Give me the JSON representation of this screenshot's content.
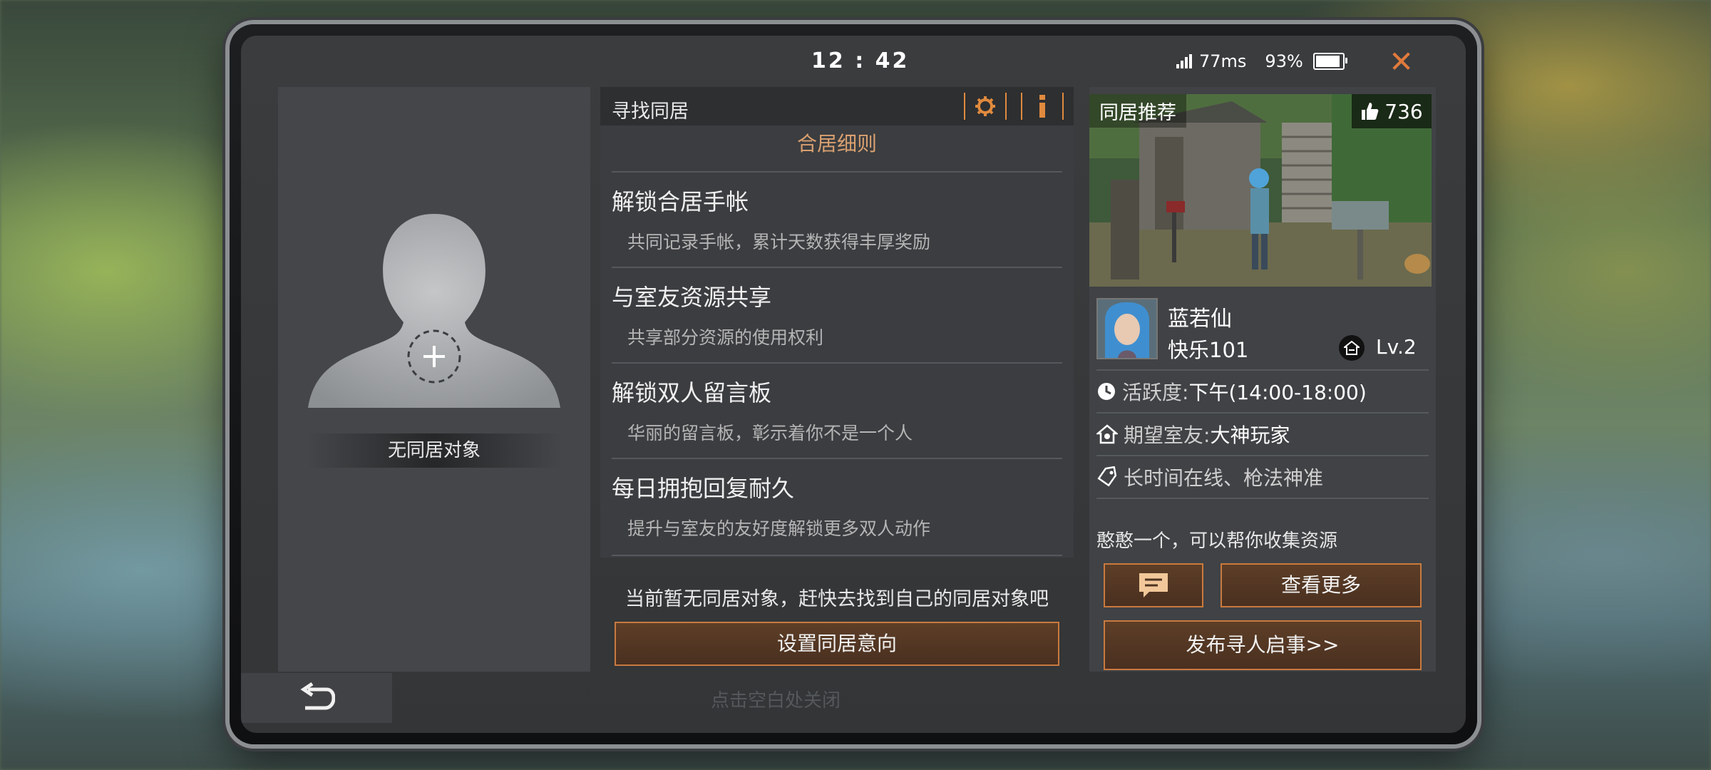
{
  "status_bar": {
    "time": "12 : 42",
    "ping": "77ms",
    "battery": "93%",
    "battery_level": 0.93
  },
  "left": {
    "no_partner_label": "无同居对象",
    "close_hint": "点击空白处关闭"
  },
  "middle": {
    "title": "寻找同居",
    "rules_title": "合居细则",
    "rules": [
      {
        "title": "解锁合居手帐",
        "desc": "共同记录手帐，累计天数获得丰厚奖励"
      },
      {
        "title": "与室友资源共享",
        "desc": "共享部分资源的使用权利"
      },
      {
        "title": "解锁双人留言板",
        "desc": "华丽的留言板，彰示着你不是一个人"
      },
      {
        "title": "每日拥抱回复耐久",
        "desc": "提升与室友的友好度解锁更多双人动作"
      }
    ],
    "hint": "当前暂无同居对象，赶快去找到自己的同居对象吧",
    "set_button": "设置同居意向"
  },
  "right": {
    "rec_label": "同居推荐",
    "likes": "736",
    "user_name": "蓝若仙",
    "server": "快乐101",
    "level": "Lv.2",
    "activity_key": "活跃度:",
    "activity_val": "下午(14:00-18:00)",
    "expect_key": "期望室友:",
    "expect_val": "大神玩家",
    "tags": "长时间在线、枪法神准",
    "bio": "憨憨一个，可以帮你收集资源",
    "more_button": "查看更多",
    "post_button": "发布寻人启事>>"
  },
  "colors": {
    "accent": "#e08a3e",
    "button_bg": "#4e3322",
    "panel": "#404245"
  },
  "icons": [
    "close-icon",
    "signal-icon",
    "battery-icon",
    "gear-icon",
    "info-icon",
    "plus-icon",
    "back-icon",
    "thumbs-up-icon",
    "house-icon",
    "clock-icon",
    "home-heart-icon",
    "tag-icon",
    "message-icon"
  ]
}
